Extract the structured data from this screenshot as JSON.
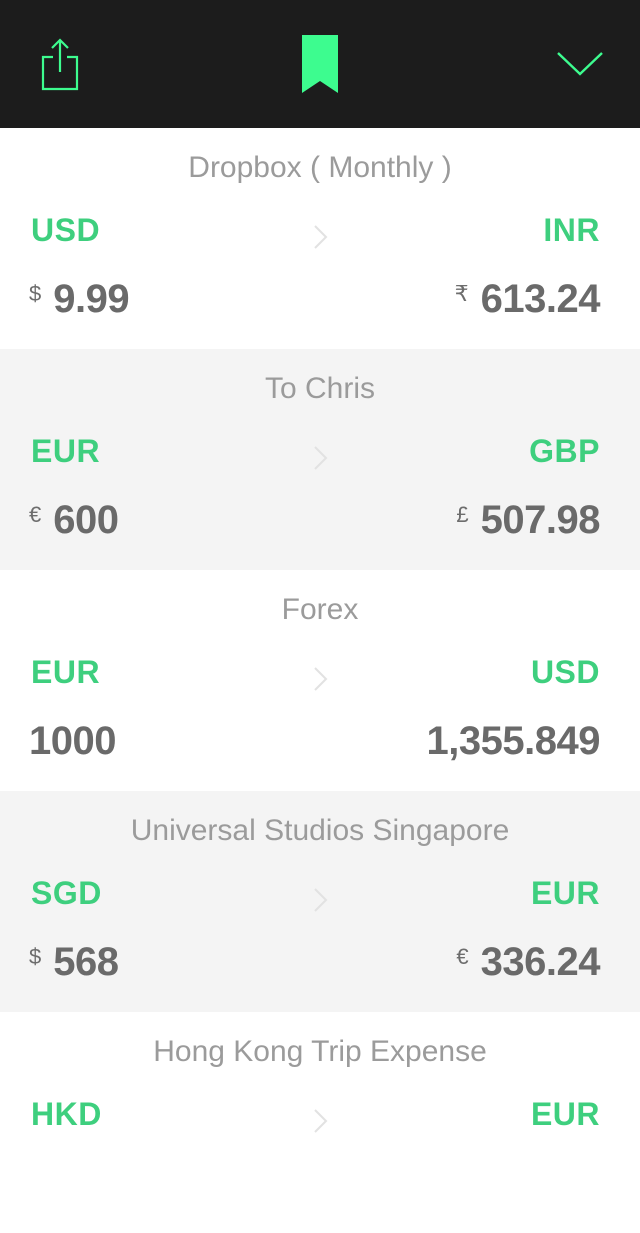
{
  "topbar": {
    "share_icon": "share-icon",
    "bookmark_icon": "bookmark-icon",
    "collapse_icon": "chevron-down-icon",
    "background": "#1c1c1c",
    "accent": "#3dfc8f"
  },
  "theme": {
    "code_color": "#3ecf7e",
    "title_color": "#9b9b9b",
    "amount_color": "#6a6a6a",
    "alt_row_bg": "#f4f4f4"
  },
  "conversions": [
    {
      "title": "Dropbox ( Monthly )",
      "from_code": "USD",
      "to_code": "INR",
      "from_symbol": "$",
      "from_amount": "9.99",
      "to_symbol": "₹",
      "to_amount": "613.24"
    },
    {
      "title": "To Chris",
      "from_code": "EUR",
      "to_code": "GBP",
      "from_symbol": "€",
      "from_amount": "600",
      "to_symbol": "£",
      "to_amount": "507.98"
    },
    {
      "title": "Forex",
      "from_code": "EUR",
      "to_code": "USD",
      "from_symbol": "",
      "from_amount": "1000",
      "to_symbol": "",
      "to_amount": "1,355.849"
    },
    {
      "title": "Universal Studios Singapore",
      "from_code": "SGD",
      "to_code": "EUR",
      "from_symbol": "$",
      "from_amount": "568",
      "to_symbol": "€",
      "to_amount": "336.24"
    },
    {
      "title": "Hong Kong Trip Expense",
      "from_code": "HKD",
      "to_code": "EUR",
      "from_symbol": "",
      "from_amount": "",
      "to_symbol": "",
      "to_amount": ""
    }
  ]
}
